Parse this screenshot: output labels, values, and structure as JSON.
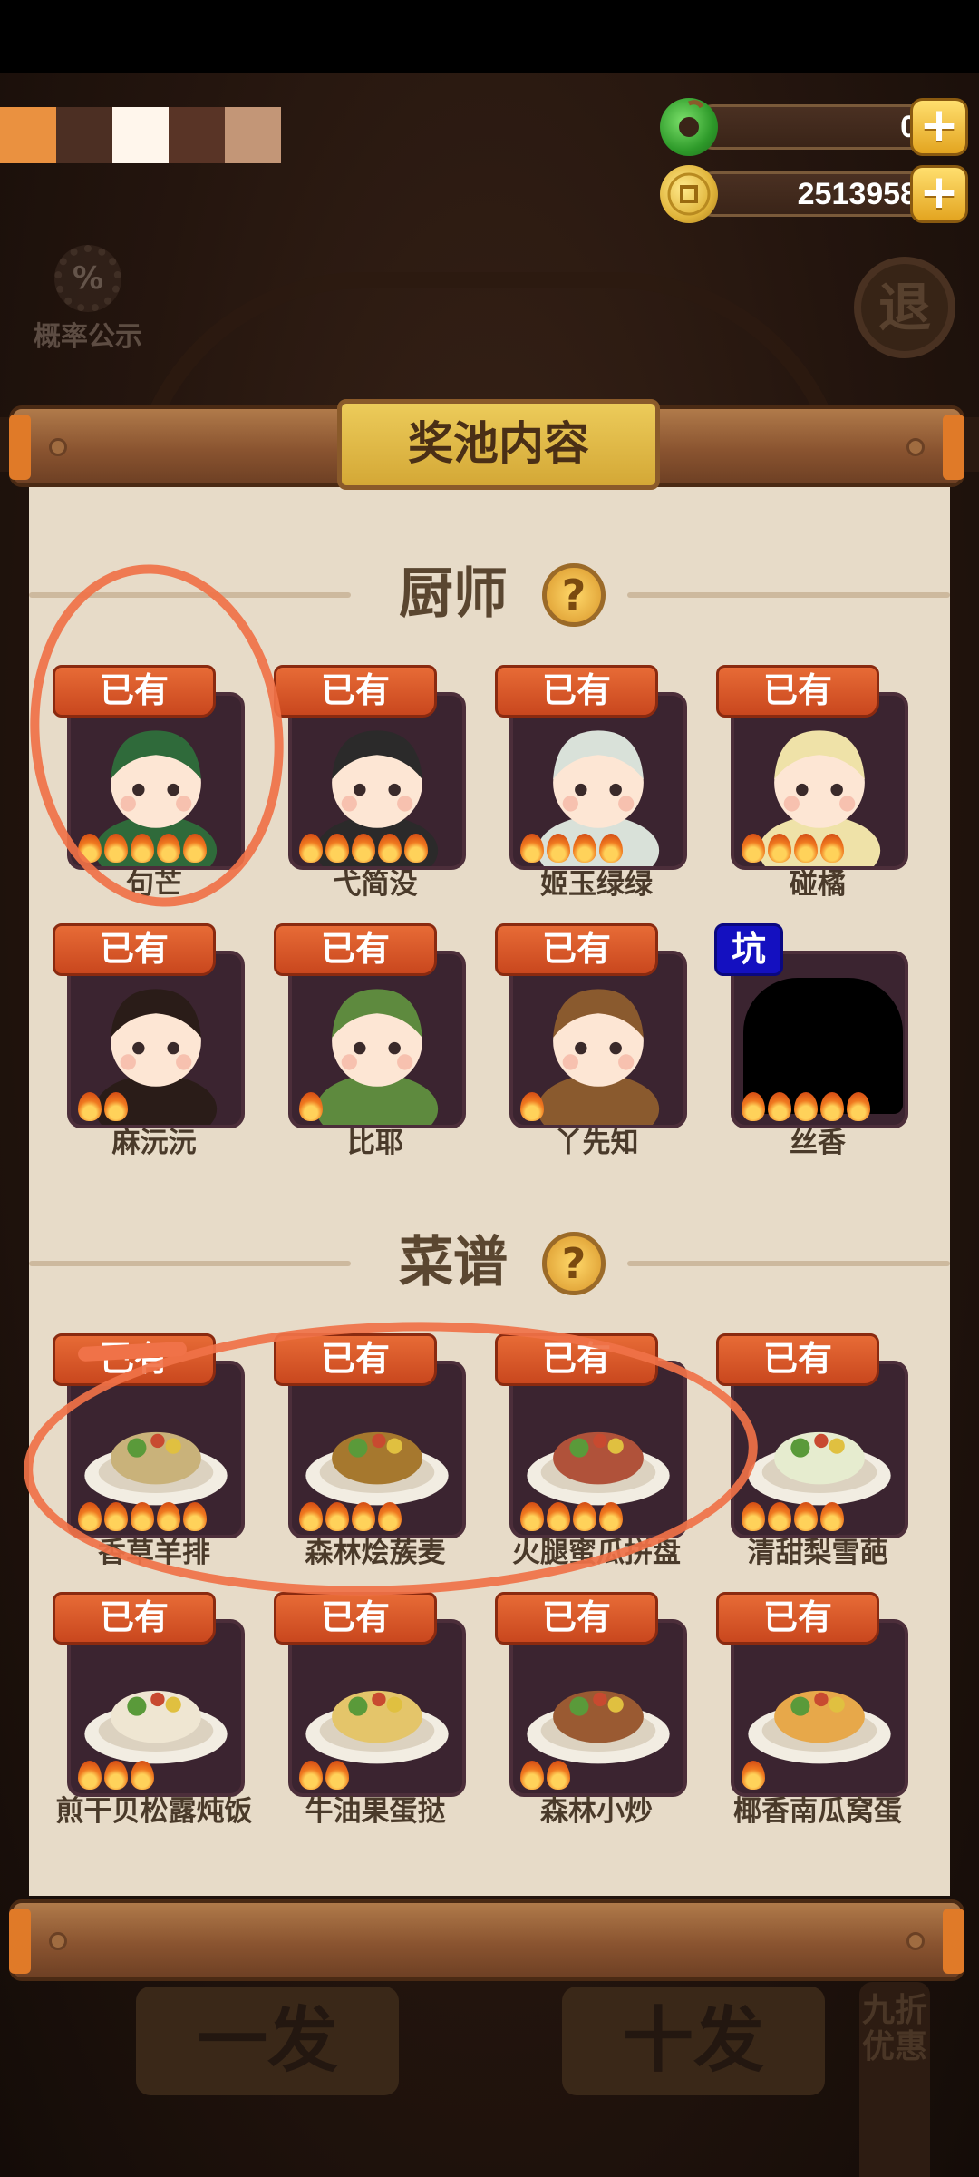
{
  "swatches": [
    "#ea9140",
    "#4c2f23",
    "#fff6ec",
    "#593426",
    "#c39677"
  ],
  "resources": {
    "jade": {
      "value": "0",
      "icon": "jade-icon",
      "plus": "+"
    },
    "coins": {
      "value": "2513958",
      "icon": "coin-icon",
      "plus": "+"
    }
  },
  "probability_label": "概率公示",
  "probability_glyph": "%",
  "exit_label": "退",
  "panel_title": "奖池内容",
  "help_glyph": "?",
  "chef_section": {
    "title": "厨师",
    "items": [
      {
        "badge": "已有",
        "name": "句芒",
        "flames": 5,
        "color": "#2f6a3a"
      },
      {
        "badge": "已有",
        "name": "弋简没",
        "flames": 5,
        "color": "#2b2a2a"
      },
      {
        "badge": "已有",
        "name": "姬玉绿绿",
        "flames": 4,
        "color": "#d9e1d9"
      },
      {
        "badge": "已有",
        "name": "碰橘",
        "flames": 4,
        "color": "#efe2a8"
      },
      {
        "badge": "已有",
        "name": "麻沅沅",
        "flames": 2,
        "color": "#2a1c18"
      },
      {
        "badge": "已有",
        "name": "比耶",
        "flames": 1,
        "color": "#5e8a3e"
      },
      {
        "badge": "已有",
        "name": "丫先知",
        "flames": 1,
        "color": "#8a5a2e"
      },
      {
        "badge": "坑",
        "name": "丝香",
        "flames": 5,
        "color": "#000000"
      }
    ]
  },
  "recipe_section": {
    "title": "菜谱",
    "items": [
      {
        "badge": "已有",
        "name": "香草羊排",
        "flames": 5,
        "color": "#c9b27a"
      },
      {
        "badge": "已有",
        "name": "森林烩蔟麦",
        "flames": 4,
        "color": "#a6782e"
      },
      {
        "badge": "已有",
        "name": "火腿蜜瓜拼盘",
        "flames": 4,
        "color": "#b0523a"
      },
      {
        "badge": "已有",
        "name": "清甜梨雪葩",
        "flames": 4,
        "color": "#e6eccf"
      },
      {
        "badge": "已有",
        "name": "煎干贝松露炖饭",
        "flames": 3,
        "color": "#efe6d2"
      },
      {
        "badge": "已有",
        "name": "牛油果蛋挞",
        "flames": 2,
        "color": "#e4c56a"
      },
      {
        "badge": "已有",
        "name": "森林小炒",
        "flames": 2,
        "color": "#9a5a32"
      },
      {
        "badge": "已有",
        "name": "椰香南瓜窝蛋",
        "flames": 1,
        "color": "#e7a84a"
      }
    ]
  },
  "bottom": {
    "single": "一发",
    "ten": "十发",
    "discount": "九折优惠"
  }
}
